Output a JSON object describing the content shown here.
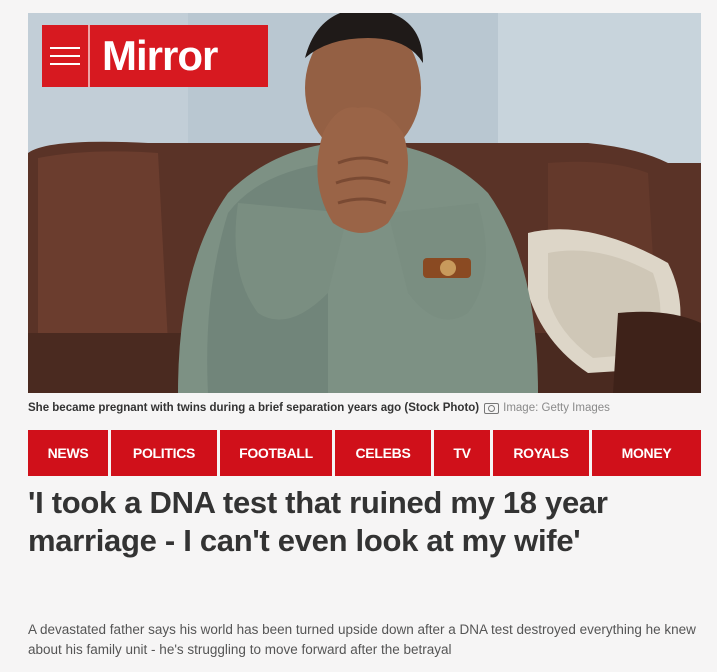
{
  "brand": {
    "name": "Mirror",
    "color": "#d71920"
  },
  "hero": {
    "image_description_icon": "stock-photo-distressed-man",
    "caption": "She became pregnant with twins during a brief separation years ago (Stock Photo)",
    "credit": "Image: Getty Images"
  },
  "nav": {
    "items": [
      {
        "label": "NEWS"
      },
      {
        "label": "POLITICS"
      },
      {
        "label": "FOOTBALL"
      },
      {
        "label": "CELEBS"
      },
      {
        "label": "TV"
      },
      {
        "label": "ROYALS"
      },
      {
        "label": "MONEY"
      }
    ],
    "color": "#d0101a"
  },
  "article": {
    "headline": "'I took a DNA test that ruined my 18 year marriage - I can't even look at my wife'",
    "standfirst": "A devastated father says his world has been turned upside down after a DNA test destroyed everything he knew about his family unit - he's struggling to move forward after the betrayal"
  }
}
